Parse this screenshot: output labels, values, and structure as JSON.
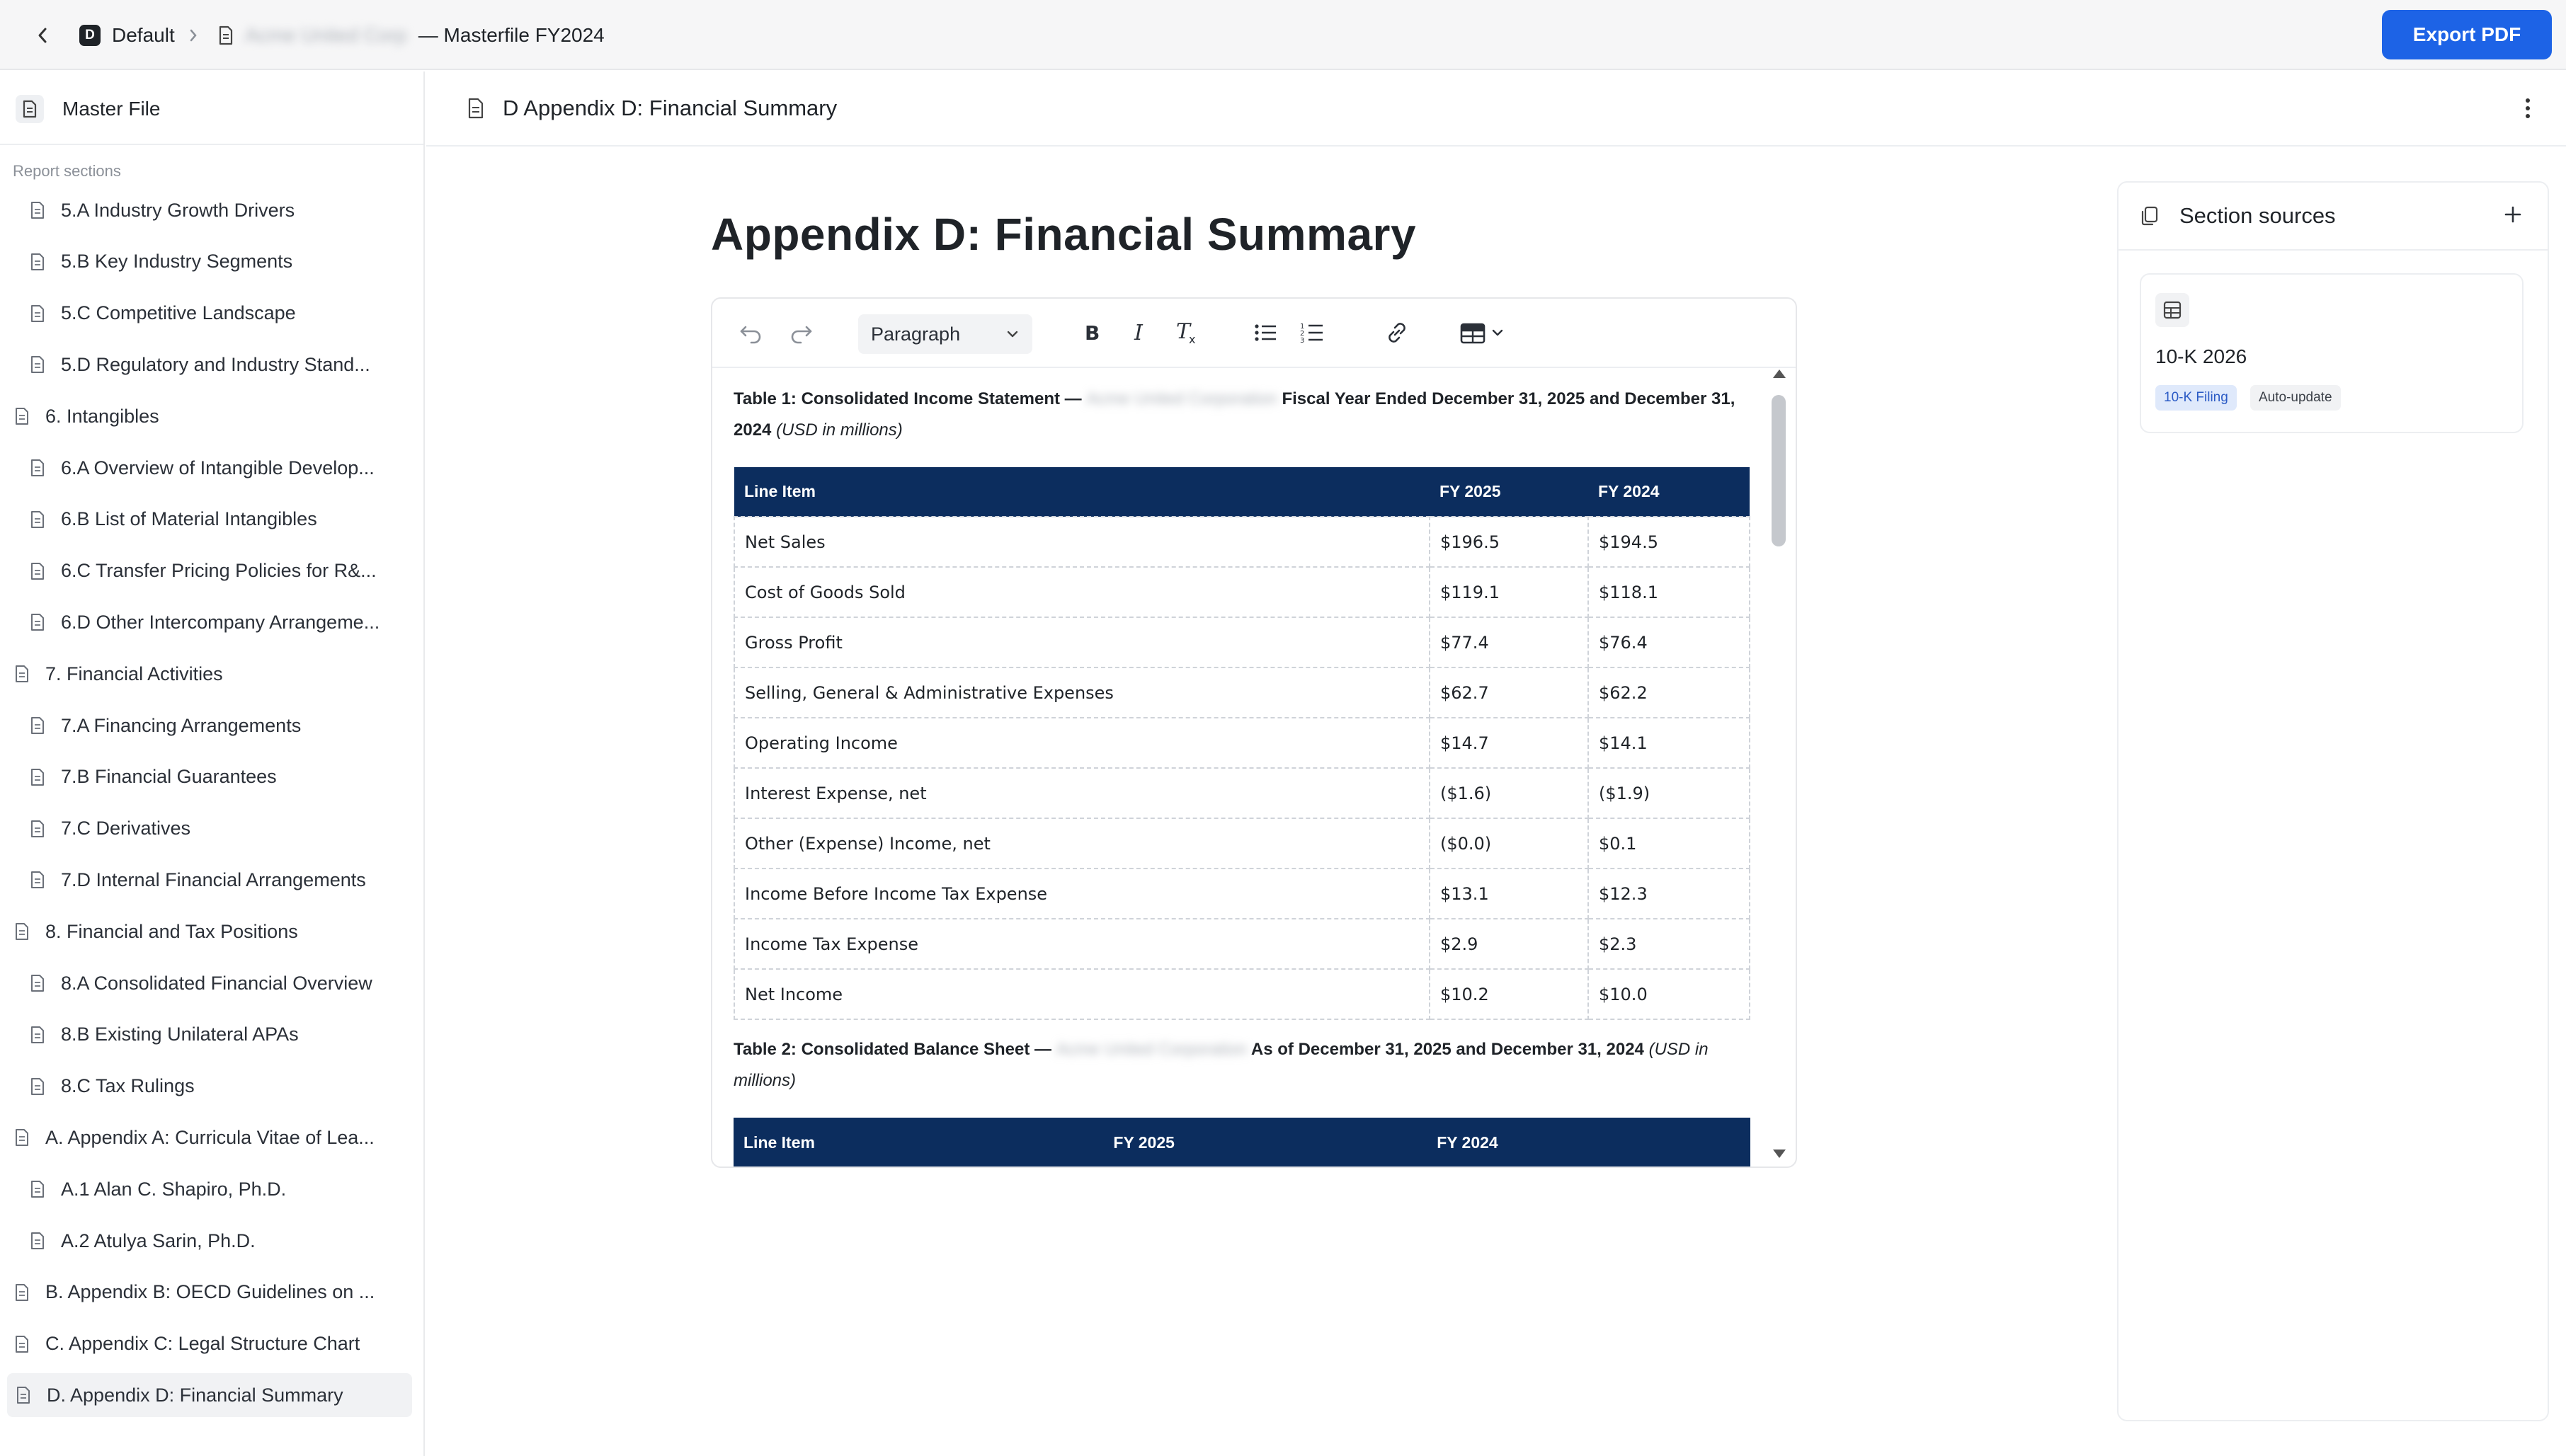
{
  "topbar": {
    "workspace_badge": "D",
    "workspace_name": "Default",
    "doc_blurred": "Acme United Corp",
    "doc_title": "— Masterfile FY2024",
    "export_label": "Export PDF"
  },
  "sidebar": {
    "master_file": "Master File",
    "sections_heading": "Report sections",
    "items": [
      {
        "label": "5.A Industry Growth Drivers",
        "level": 2
      },
      {
        "label": "5.B Key Industry Segments",
        "level": 2
      },
      {
        "label": "5.C Competitive Landscape",
        "level": 2
      },
      {
        "label": "5.D Regulatory and Industry Stand...",
        "level": 2
      },
      {
        "label": "6. Intangibles",
        "level": 1
      },
      {
        "label": "6.A Overview of Intangible Develop...",
        "level": 2
      },
      {
        "label": "6.B List of Material Intangibles",
        "level": 2
      },
      {
        "label": "6.C Transfer Pricing Policies for R&...",
        "level": 2
      },
      {
        "label": "6.D Other Intercompany Arrangeme...",
        "level": 2
      },
      {
        "label": "7. Financial Activities",
        "level": 1
      },
      {
        "label": "7.A Financing Arrangements",
        "level": 2
      },
      {
        "label": "7.B Financial Guarantees",
        "level": 2
      },
      {
        "label": "7.C Derivatives",
        "level": 2
      },
      {
        "label": "7.D Internal Financial Arrangements",
        "level": 2
      },
      {
        "label": "8. Financial and Tax Positions",
        "level": 1
      },
      {
        "label": "8.A Consolidated Financial Overview",
        "level": 2
      },
      {
        "label": "8.B Existing Unilateral APAs",
        "level": 2
      },
      {
        "label": "8.C Tax Rulings",
        "level": 2
      },
      {
        "label": "A. Appendix A: Curricula Vitae of Lea...",
        "level": 1
      },
      {
        "label": "A.1 Alan C. Shapiro, Ph.D.",
        "level": 2
      },
      {
        "label": "A.2 Atulya Sarin, Ph.D.",
        "level": 2
      },
      {
        "label": "B. Appendix B: OECD Guidelines on ...",
        "level": 1
      },
      {
        "label": "C. Appendix C: Legal Structure Chart",
        "level": 1
      },
      {
        "label": "D. Appendix D: Financial Summary",
        "level": 1,
        "active": true
      }
    ]
  },
  "main": {
    "header_title": "D Appendix D: Financial Summary",
    "page_heading": "Appendix D: Financial Summary"
  },
  "editor": {
    "paragraph_style": "Paragraph",
    "table1": {
      "caption_prefix": "Table 1: Consolidated Income Statement —",
      "caption_blurred": "Acme United Corporation",
      "caption_suffix": "Fiscal Year Ended December 31, 2025 and December 31, 2024",
      "caption_unit": "(USD in millions)",
      "headers": [
        "Line Item",
        "FY 2025",
        "FY 2024"
      ],
      "rows": [
        [
          "Net Sales",
          "$196.5",
          "$194.5"
        ],
        [
          "Cost of Goods Sold",
          "$119.1",
          "$118.1"
        ],
        [
          "Gross Profit",
          "$77.4",
          "$76.4"
        ],
        [
          "Selling, General & Administrative Expenses",
          "$62.7",
          "$62.2"
        ],
        [
          "Operating Income",
          "$14.7",
          "$14.1"
        ],
        [
          "Interest Expense, net",
          "($1.6)",
          "($1.9)"
        ],
        [
          "Other (Expense) Income, net",
          "($0.0)",
          "$0.1"
        ],
        [
          "Income Before Income Tax Expense",
          "$13.1",
          "$12.3"
        ],
        [
          "Income Tax Expense",
          "$2.9",
          "$2.3"
        ],
        [
          "Net Income",
          "$10.2",
          "$10.0"
        ]
      ]
    },
    "table2": {
      "caption_prefix": "Table 2: Consolidated Balance Sheet —",
      "caption_blurred": "Acme United Corporation",
      "caption_suffix": "As of December 31, 2025 and December 31, 2024",
      "caption_unit": "(USD in millions)",
      "headers": [
        "Line Item",
        "FY 2025",
        "FY 2024"
      ]
    }
  },
  "sources": {
    "title": "Section sources",
    "card": {
      "title": "10-K 2026",
      "tag_filing": "10-K Filing",
      "tag_auto": "Auto-update"
    }
  },
  "colors": {
    "accent": "#1d63e6",
    "table_header": "#0c2d5e",
    "active_row": "#f1f2f4"
  }
}
